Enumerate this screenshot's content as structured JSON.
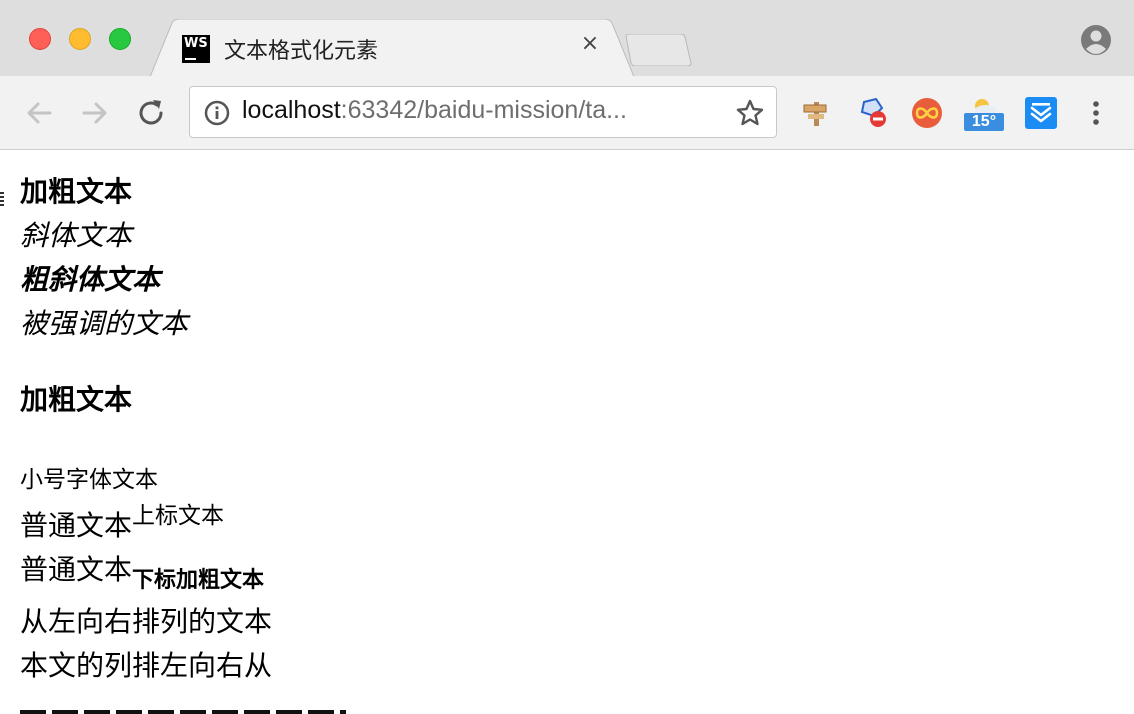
{
  "tab": {
    "title": "文本格式化元素",
    "favicon_text": "WS",
    "close_glyph": "×"
  },
  "address_bar": {
    "url_host": "localhost",
    "url_rest": ":63342/baidu-mission/ta..."
  },
  "extensions": {
    "weather_temp": "15°"
  },
  "content": {
    "bold_text": "加粗文本",
    "italic_text": "斜体文本",
    "bold_italic_text": "粗斜体文本",
    "emphasized_text": "被强调的文本",
    "bold_text_2": "加粗文本",
    "small_text": "小号字体文本",
    "normal_text_1": "普通文本",
    "superscript_text": "上标文本",
    "normal_text_2": "普通文本",
    "subscript_bold_text": "下标加粗文本",
    "ltr_text": "从左向右排列的文本",
    "rtl_text": "本文的列排左向右从"
  },
  "colors": {
    "tabstrip_bg": "#dedede",
    "toolbar_bg": "#f2f2f2",
    "close_red": "#fe5f57",
    "minimize_yellow": "#febc2e",
    "zoom_green": "#28c840"
  }
}
